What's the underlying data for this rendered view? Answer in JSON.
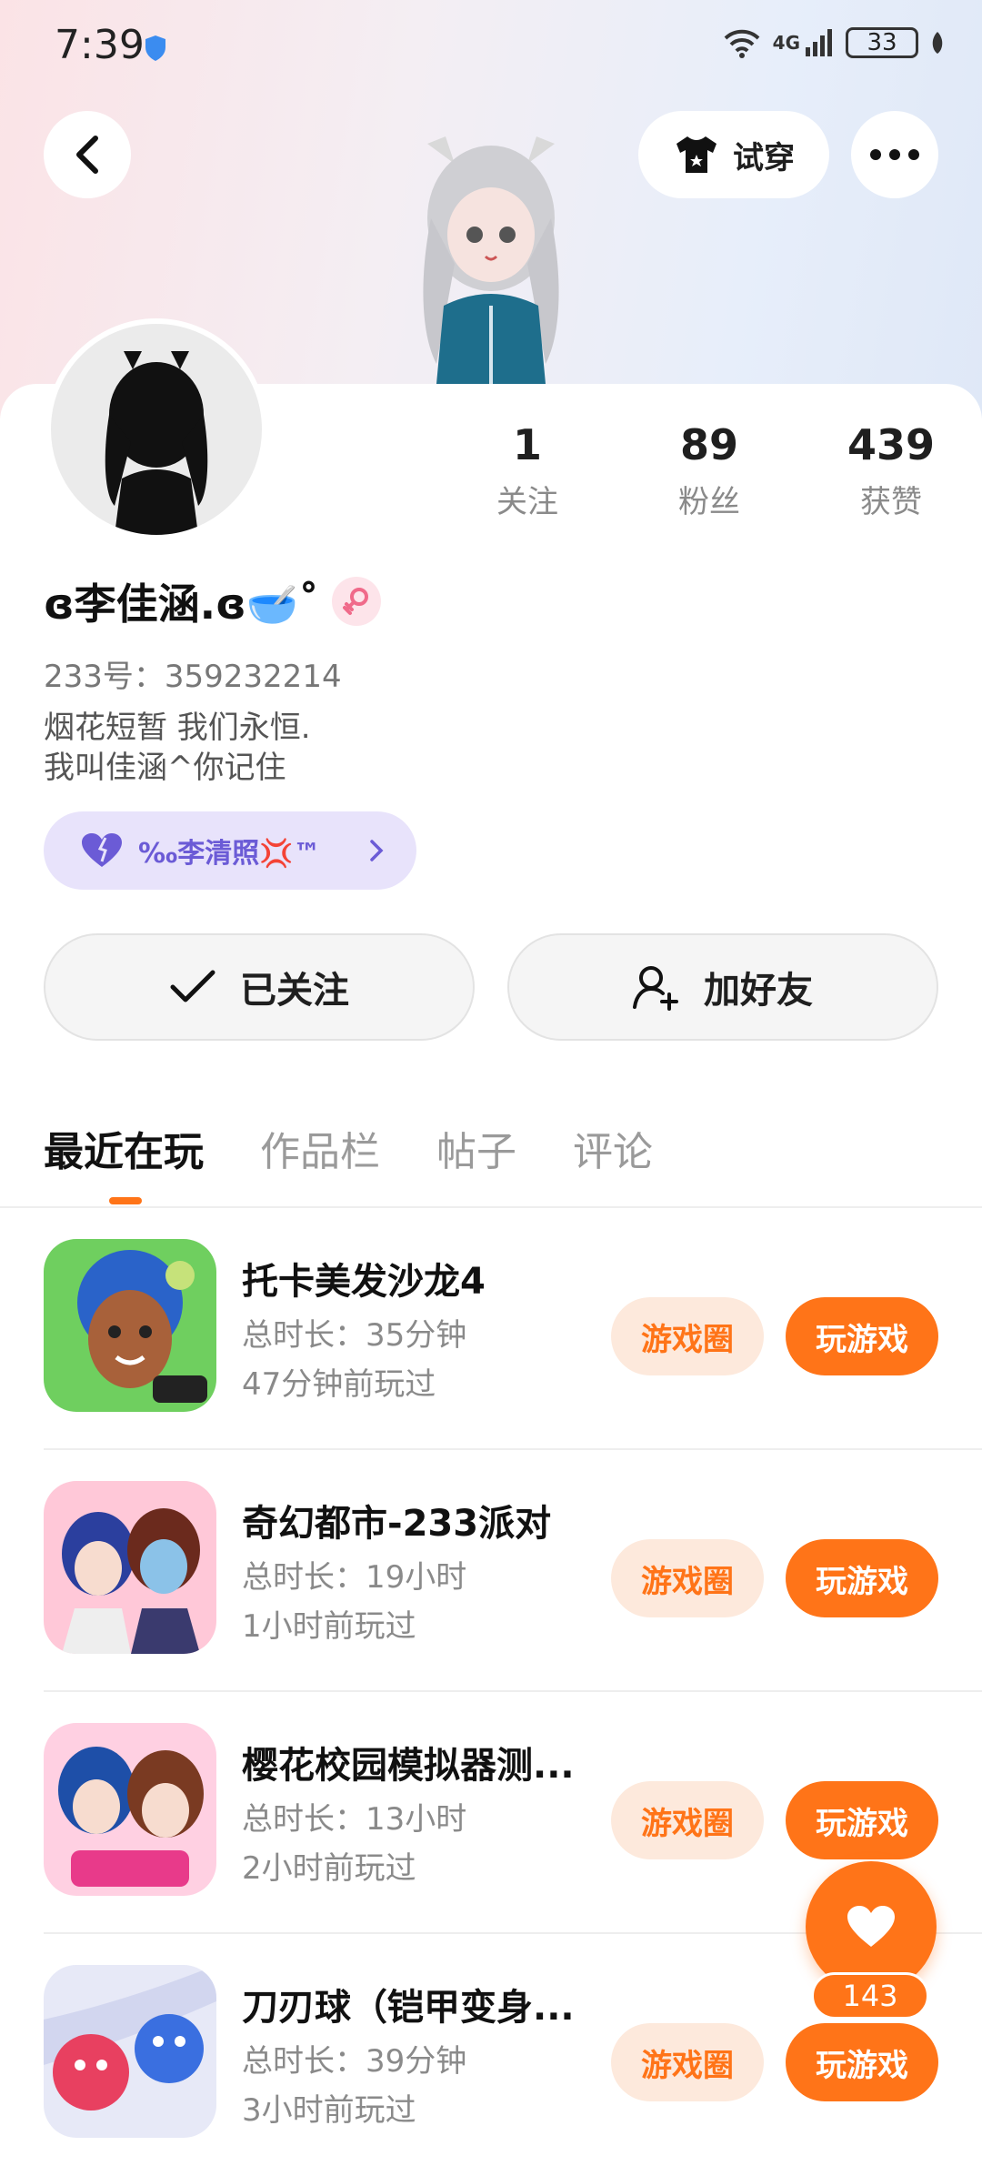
{
  "status_bar": {
    "time": "7:39",
    "network": "4G",
    "battery": "33"
  },
  "header": {
    "try_on_label": "试穿"
  },
  "profile": {
    "name": "ɞ李佳涵.ɞ🥣˚",
    "uid": "233号：359232214",
    "bio": "烟花短暂 我们永恒.\n我叫佳涵^你记住",
    "relation_chip": "‰李清照💢™",
    "stats": [
      {
        "value": "1",
        "label": "关注"
      },
      {
        "value": "89",
        "label": "粉丝"
      },
      {
        "value": "439",
        "label": "获赞"
      }
    ]
  },
  "actions": {
    "follow_label": "已关注",
    "add_friend_label": "加好友"
  },
  "tabs": [
    {
      "label": "最近在玩",
      "active": true
    },
    {
      "label": "作品栏",
      "active": false
    },
    {
      "label": "帖子",
      "active": false
    },
    {
      "label": "评论",
      "active": false
    }
  ],
  "games": [
    {
      "title": "托卡美发沙龙4",
      "duration": "总时长：35分钟",
      "last_played": "47分钟前玩过",
      "circle_label": "游戏圈",
      "play_label": "玩游戏"
    },
    {
      "title": "奇幻都市-233派对",
      "duration": "总时长：19小时",
      "last_played": "1小时前玩过",
      "circle_label": "游戏圈",
      "play_label": "玩游戏"
    },
    {
      "title": "樱花校园模拟器测...",
      "duration": "总时长：13小时",
      "last_played": "2小时前玩过",
      "circle_label": "游戏圈",
      "play_label": "玩游戏"
    },
    {
      "title": "刀刃球（铠甲变身...",
      "duration": "总时长：39分钟",
      "last_played": "3小时前玩过",
      "circle_label": "游戏圈",
      "play_label": "玩游戏"
    }
  ],
  "like_fab": {
    "count": "143"
  },
  "colors": {
    "accent": "#ff7418",
    "accent_light": "#fde9dc",
    "chip_bg": "#e8e3fb",
    "chip_text": "#6b5bd6"
  },
  "icons": [
    "shield-icon",
    "wifi-icon",
    "signal-icon",
    "battery-icon",
    "back-icon",
    "shirt-icon",
    "more-icon",
    "gender-female-icon",
    "heart-icon",
    "chevron-right-icon",
    "check-icon",
    "add-user-icon"
  ]
}
